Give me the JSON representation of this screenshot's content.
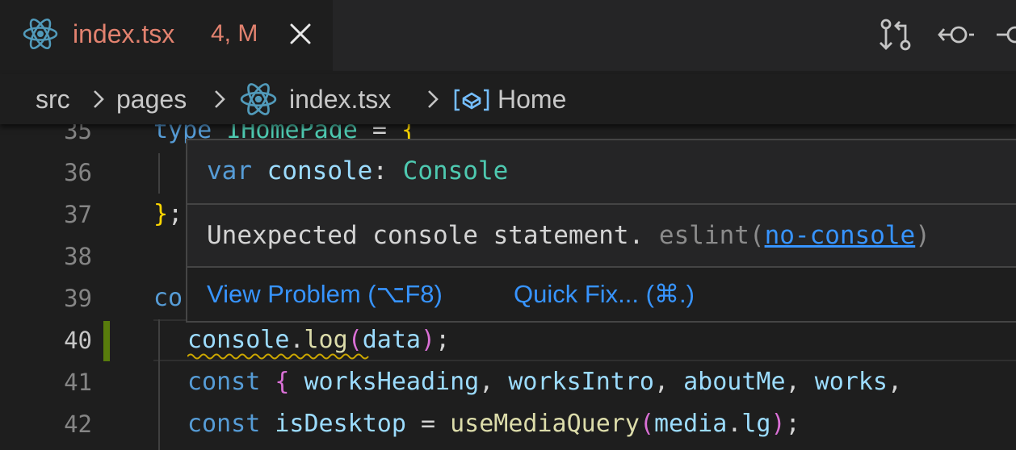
{
  "tab": {
    "file_name": "index.tsx",
    "badge": "4, M",
    "file_icon": "react-icon",
    "close_icon": "close-icon"
  },
  "toolbar": {
    "icons": [
      "compare-changes-icon",
      "git-commit-back-icon",
      "git-commit-icon"
    ]
  },
  "breadcrumb": {
    "items": [
      "src",
      "pages",
      "index.tsx",
      "Home"
    ],
    "separator_icon": "chevron-right-icon",
    "home_icon": "symbol-variable-icon"
  },
  "editor": {
    "line_numbers": [
      "35",
      "36",
      "37",
      "38",
      "39",
      "40",
      "41",
      "42"
    ],
    "current_line": "40",
    "lines": {
      "l35": {
        "kw": "type",
        "name": "IHomePage",
        "eq": " = ",
        "brace": "{"
      },
      "l37": {
        "brace": "}",
        "semi": ";"
      },
      "l39": {
        "kw": "co"
      },
      "l40": {
        "obj": "console",
        "dot": ".",
        "fn": "log",
        "open": "(",
        "arg": "data",
        "close": ")",
        "semi": ";"
      },
      "l41": {
        "kw": "const",
        "open": " { ",
        "vars": [
          "worksHeading",
          "worksIntro",
          "aboutMe",
          "works"
        ],
        "sep": ", "
      },
      "l42": {
        "kw": "const",
        "name": "isDesktop",
        "eq": " = ",
        "fn": "useMediaQuery",
        "open": "(",
        "obj": "media",
        "dot": ".",
        "prop": "lg",
        "close": ")",
        "semi": ";"
      }
    }
  },
  "hover": {
    "sig_kw": "var",
    "sig_name": "console",
    "sig_colon": ": ",
    "sig_type": "Console",
    "message": "Unexpected console statement.",
    "source": "eslint(",
    "rule": "no-console",
    "source_close": ")",
    "actions": {
      "view_problem": "View Problem (⌥F8)",
      "quick_fix": "Quick Fix... (⌘.)"
    }
  },
  "colors": {
    "modified": "#e2826f",
    "link": "#3794ff",
    "gutter_modified": "#587c0c",
    "squiggle": "#cca700"
  }
}
